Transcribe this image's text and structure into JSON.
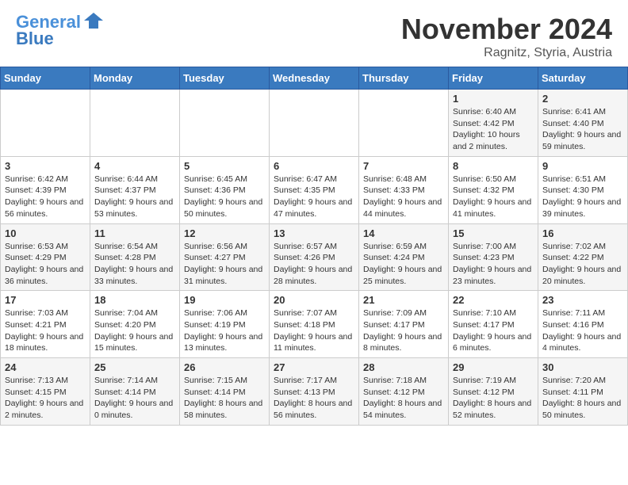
{
  "header": {
    "logo_line1": "General",
    "logo_line2": "Blue",
    "month_title": "November 2024",
    "location": "Ragnitz, Styria, Austria"
  },
  "weekdays": [
    "Sunday",
    "Monday",
    "Tuesday",
    "Wednesday",
    "Thursday",
    "Friday",
    "Saturday"
  ],
  "weeks": [
    [
      {
        "day": "",
        "info": ""
      },
      {
        "day": "",
        "info": ""
      },
      {
        "day": "",
        "info": ""
      },
      {
        "day": "",
        "info": ""
      },
      {
        "day": "",
        "info": ""
      },
      {
        "day": "1",
        "info": "Sunrise: 6:40 AM\nSunset: 4:42 PM\nDaylight: 10 hours and 2 minutes."
      },
      {
        "day": "2",
        "info": "Sunrise: 6:41 AM\nSunset: 4:40 PM\nDaylight: 9 hours and 59 minutes."
      }
    ],
    [
      {
        "day": "3",
        "info": "Sunrise: 6:42 AM\nSunset: 4:39 PM\nDaylight: 9 hours and 56 minutes."
      },
      {
        "day": "4",
        "info": "Sunrise: 6:44 AM\nSunset: 4:37 PM\nDaylight: 9 hours and 53 minutes."
      },
      {
        "day": "5",
        "info": "Sunrise: 6:45 AM\nSunset: 4:36 PM\nDaylight: 9 hours and 50 minutes."
      },
      {
        "day": "6",
        "info": "Sunrise: 6:47 AM\nSunset: 4:35 PM\nDaylight: 9 hours and 47 minutes."
      },
      {
        "day": "7",
        "info": "Sunrise: 6:48 AM\nSunset: 4:33 PM\nDaylight: 9 hours and 44 minutes."
      },
      {
        "day": "8",
        "info": "Sunrise: 6:50 AM\nSunset: 4:32 PM\nDaylight: 9 hours and 41 minutes."
      },
      {
        "day": "9",
        "info": "Sunrise: 6:51 AM\nSunset: 4:30 PM\nDaylight: 9 hours and 39 minutes."
      }
    ],
    [
      {
        "day": "10",
        "info": "Sunrise: 6:53 AM\nSunset: 4:29 PM\nDaylight: 9 hours and 36 minutes."
      },
      {
        "day": "11",
        "info": "Sunrise: 6:54 AM\nSunset: 4:28 PM\nDaylight: 9 hours and 33 minutes."
      },
      {
        "day": "12",
        "info": "Sunrise: 6:56 AM\nSunset: 4:27 PM\nDaylight: 9 hours and 31 minutes."
      },
      {
        "day": "13",
        "info": "Sunrise: 6:57 AM\nSunset: 4:26 PM\nDaylight: 9 hours and 28 minutes."
      },
      {
        "day": "14",
        "info": "Sunrise: 6:59 AM\nSunset: 4:24 PM\nDaylight: 9 hours and 25 minutes."
      },
      {
        "day": "15",
        "info": "Sunrise: 7:00 AM\nSunset: 4:23 PM\nDaylight: 9 hours and 23 minutes."
      },
      {
        "day": "16",
        "info": "Sunrise: 7:02 AM\nSunset: 4:22 PM\nDaylight: 9 hours and 20 minutes."
      }
    ],
    [
      {
        "day": "17",
        "info": "Sunrise: 7:03 AM\nSunset: 4:21 PM\nDaylight: 9 hours and 18 minutes."
      },
      {
        "day": "18",
        "info": "Sunrise: 7:04 AM\nSunset: 4:20 PM\nDaylight: 9 hours and 15 minutes."
      },
      {
        "day": "19",
        "info": "Sunrise: 7:06 AM\nSunset: 4:19 PM\nDaylight: 9 hours and 13 minutes."
      },
      {
        "day": "20",
        "info": "Sunrise: 7:07 AM\nSunset: 4:18 PM\nDaylight: 9 hours and 11 minutes."
      },
      {
        "day": "21",
        "info": "Sunrise: 7:09 AM\nSunset: 4:17 PM\nDaylight: 9 hours and 8 minutes."
      },
      {
        "day": "22",
        "info": "Sunrise: 7:10 AM\nSunset: 4:17 PM\nDaylight: 9 hours and 6 minutes."
      },
      {
        "day": "23",
        "info": "Sunrise: 7:11 AM\nSunset: 4:16 PM\nDaylight: 9 hours and 4 minutes."
      }
    ],
    [
      {
        "day": "24",
        "info": "Sunrise: 7:13 AM\nSunset: 4:15 PM\nDaylight: 9 hours and 2 minutes."
      },
      {
        "day": "25",
        "info": "Sunrise: 7:14 AM\nSunset: 4:14 PM\nDaylight: 9 hours and 0 minutes."
      },
      {
        "day": "26",
        "info": "Sunrise: 7:15 AM\nSunset: 4:14 PM\nDaylight: 8 hours and 58 minutes."
      },
      {
        "day": "27",
        "info": "Sunrise: 7:17 AM\nSunset: 4:13 PM\nDaylight: 8 hours and 56 minutes."
      },
      {
        "day": "28",
        "info": "Sunrise: 7:18 AM\nSunset: 4:12 PM\nDaylight: 8 hours and 54 minutes."
      },
      {
        "day": "29",
        "info": "Sunrise: 7:19 AM\nSunset: 4:12 PM\nDaylight: 8 hours and 52 minutes."
      },
      {
        "day": "30",
        "info": "Sunrise: 7:20 AM\nSunset: 4:11 PM\nDaylight: 8 hours and 50 minutes."
      }
    ]
  ]
}
